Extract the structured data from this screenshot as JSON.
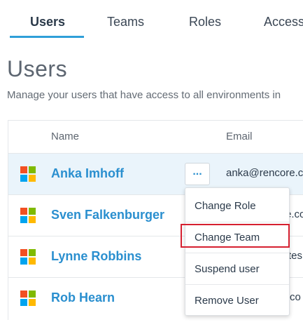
{
  "tabs": [
    {
      "label": "Users",
      "active": true
    },
    {
      "label": "Teams"
    },
    {
      "label": "Roles"
    },
    {
      "label": "Access"
    }
  ],
  "page": {
    "title": "Users",
    "description": "Manage your users that have access to all environments in"
  },
  "table": {
    "columns": {
      "name": "Name",
      "email": "Email"
    },
    "rows": [
      {
        "name": "Anka Imhoff",
        "email": "anka@rencore.co",
        "icon": "microsoft-logo-icon"
      },
      {
        "name": "Sven Falkenburger",
        "email": "e.co",
        "icon": "microsoft-logo-icon"
      },
      {
        "name": "Lynne Robbins",
        "email": "tes",
        "icon": "microsoft-logo-icon"
      },
      {
        "name": "Rob Hearn",
        "email": "co",
        "icon": "microsoft-logo-icon"
      }
    ],
    "more_button_label": "..."
  },
  "context_menu": {
    "items": [
      "Change Role",
      "Change Team",
      "Suspend user",
      "Remove User"
    ],
    "highlighted": "Change Team"
  },
  "colors": {
    "accent": "#2f9fd8",
    "link": "#2a8fcf",
    "highlight_row": "#eaf4fb",
    "focus_border": "#d62030"
  }
}
